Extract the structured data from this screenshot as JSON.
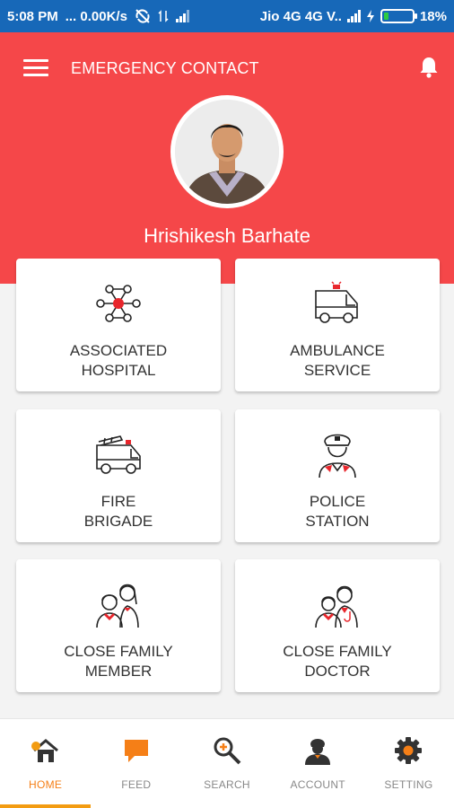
{
  "status_bar": {
    "time": "5:08 PM",
    "speed": "... 0.00K/s",
    "carrier": "Jio 4G 4G V..",
    "battery": "18%"
  },
  "header": {
    "title": "EMERGENCY CONTACT",
    "user_name": "Hrishikesh Barhate",
    "background_color": "#f54749"
  },
  "cards": [
    {
      "label": "ASSOCIATED\nHOSPITAL",
      "icon": "network-icon"
    },
    {
      "label": "AMBULANCE\nSERVICE",
      "icon": "ambulance-icon"
    },
    {
      "label": "FIRE\nBRIGADE",
      "icon": "fire-truck-icon"
    },
    {
      "label": "POLICE\nSTATION",
      "icon": "police-officer-icon"
    },
    {
      "label": "CLOSE FAMILY\nMEMBER",
      "icon": "family-icon"
    },
    {
      "label": "CLOSE FAMILY\nDOCTOR",
      "icon": "doctor-icon"
    }
  ],
  "nav": {
    "items": [
      {
        "label": "HOME",
        "icon": "home-icon",
        "active": true
      },
      {
        "label": "FEED",
        "icon": "chat-bubble-icon"
      },
      {
        "label": "SEARCH",
        "icon": "search-icon"
      },
      {
        "label": "ACCOUNT",
        "icon": "account-icon"
      },
      {
        "label": "SETTING",
        "icon": "gear-icon"
      }
    ],
    "active_color": "#f57f17"
  }
}
